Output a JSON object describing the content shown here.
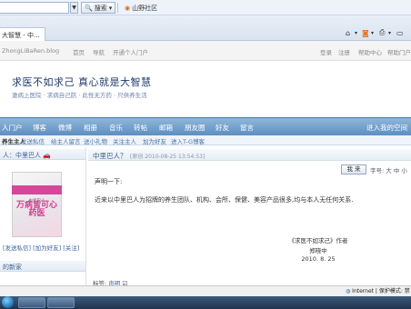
{
  "browser": {
    "search_label": "搜索",
    "community_label": "山野社区",
    "tab_title": "大智慧 - 中...",
    "cmd_icons": [
      "home-icon",
      "rss-icon",
      "print-icon",
      "page-icon"
    ]
  },
  "site_nav": {
    "url_fragment": "ZhongLiBaRen.blog",
    "items": [
      "首页",
      "导航",
      "开通个人门户"
    ],
    "right_items": [
      "登录",
      "注册",
      "帮助中心",
      "帮助门户"
    ]
  },
  "banner": {
    "title": "求医不如求己  真心就是大智慧",
    "subtitle": "激病上医院 · 求病自己防 · 此性无方药 · 只供养生活"
  },
  "main_menu": {
    "items": [
      "人门户",
      "博客",
      "微博",
      "相册",
      "音乐",
      "转帖",
      "邮箱",
      "朋友圈",
      "好友",
      "留言"
    ],
    "right_text": "进入我的空间"
  },
  "sub_menu": {
    "items": [
      "养生主人",
      "发送私信",
      "给主人留言",
      "送小礼物",
      "关注主人",
      "加为好友",
      "进入T-G博客"
    ]
  },
  "left": {
    "profile_header": "人：中里巴人",
    "book_sub": "中里巴人",
    "book_title": "万病皆可心药医",
    "links": "[发送私信] [加为好友] [关注]",
    "recent_header": "的新家"
  },
  "post": {
    "title": "中里巴人？",
    "date": "[原创 2010-08-25 13:54:53]",
    "reply_label": "我 来",
    "font_label": "字号: 大 中 小",
    "greeting": "声明一下:",
    "body": "近来以中里巴人为招牌的养生团队、机构、会所、保健、美容产品很多,均与本人无任何关系.",
    "sign_book": "《求医不如求己》作者",
    "sign_name": "郑晓中",
    "sign_date": "2010. 8. 25",
    "tags_label": "标签:",
    "tag": "声明"
  },
  "status": {
    "zone": "Internet | 保护模式: 禁"
  }
}
